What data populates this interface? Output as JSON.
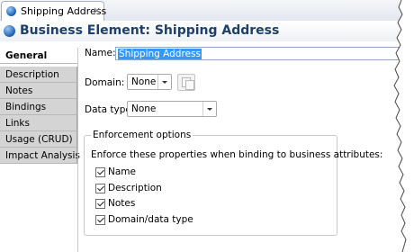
{
  "editor_tab": {
    "label": "Shipping Address",
    "close_glyph": "⨯"
  },
  "header": {
    "title": "Business Element: Shipping Address"
  },
  "sidebar": {
    "items": [
      {
        "label": "General"
      },
      {
        "label": "Description"
      },
      {
        "label": "Notes"
      },
      {
        "label": "Bindings"
      },
      {
        "label": "Links"
      },
      {
        "label": "Usage (CRUD)"
      },
      {
        "label": "Impact Analysis"
      }
    ]
  },
  "form": {
    "name_label": "Name:",
    "name_value": "Shipping Address",
    "domain_label": "Domain:",
    "domain_value": "None",
    "datatype_label": "Data type:",
    "datatype_value": "None"
  },
  "enforcement": {
    "title": "Enforcement options",
    "description": "Enforce these properties when binding to business attributes:",
    "options": [
      {
        "label": "Name",
        "checked": true
      },
      {
        "label": "Description",
        "checked": true
      },
      {
        "label": "Notes",
        "checked": true
      },
      {
        "label": "Domain/data type",
        "checked": true
      }
    ]
  },
  "colors": {
    "title": "#1f3f6b",
    "selection": "#3399ff",
    "icon": "#1a5fb4"
  },
  "icons": {
    "tab_icon": "business-element-icon",
    "domain_button": "browse-pages-icon"
  }
}
